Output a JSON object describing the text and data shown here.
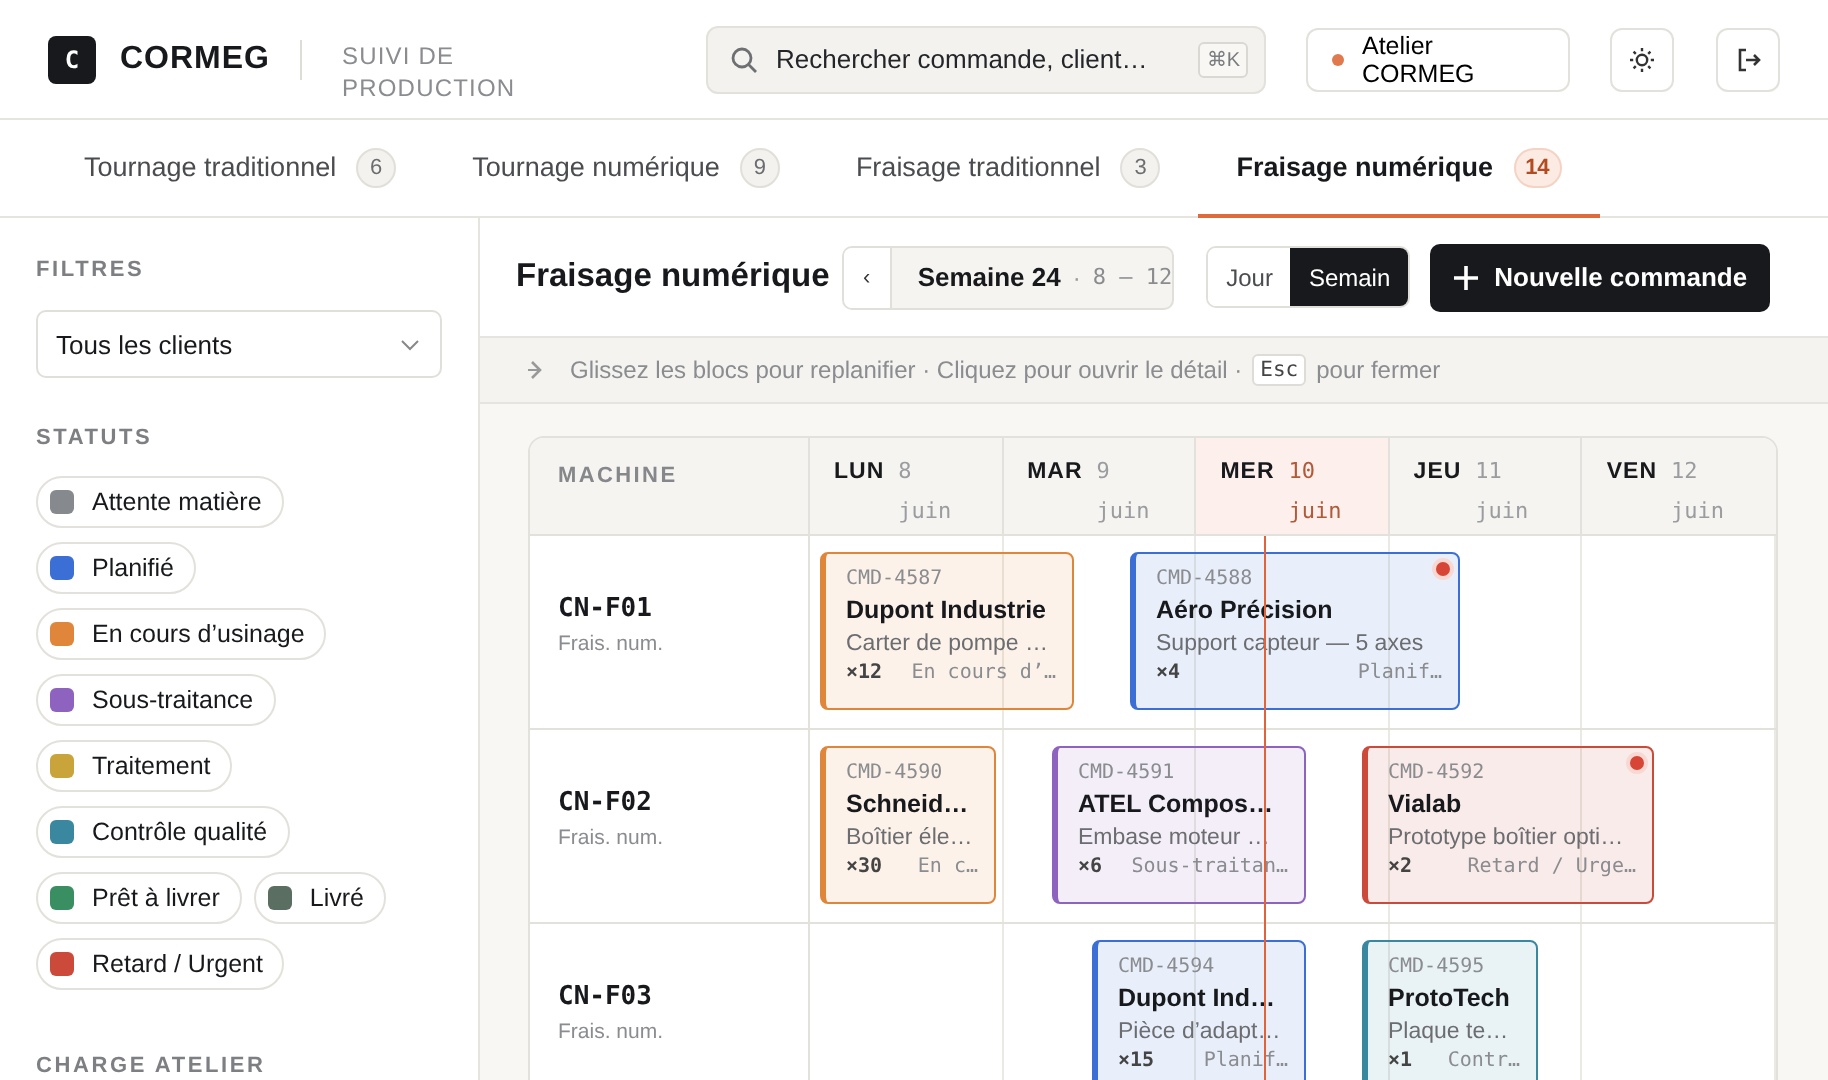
{
  "header": {
    "logo_letter": "C",
    "brand": "CORMEG",
    "subtitle": "SUIVI DE PRODUCTION",
    "search": {
      "placeholder": "Rechercher commande, client…",
      "shortcut": "⌘K"
    },
    "workshop": "Atelier CORMEG"
  },
  "tabs": [
    {
      "label": "Tournage traditionnel",
      "count": "6",
      "selected": false
    },
    {
      "label": "Tournage numérique",
      "count": "9",
      "selected": false
    },
    {
      "label": "Fraisage traditionnel",
      "count": "3",
      "selected": false
    },
    {
      "label": "Fraisage numérique",
      "count": "14",
      "selected": true
    }
  ],
  "sidebar": {
    "filters_title": "FILTRES",
    "client_select": {
      "value": "Tous les clients"
    },
    "statuses_title": "STATUTS",
    "statuses": [
      {
        "label": "Attente matière",
        "color": "#868a8e"
      },
      {
        "label": "Planifié",
        "color": "#3b6fd6"
      },
      {
        "label": "En cours d’usinage",
        "color": "#e0863a"
      },
      {
        "label": "Sous-traitance",
        "color": "#8e62bf"
      },
      {
        "label": "Traitement",
        "color": "#c9a43a"
      },
      {
        "label": "Contrôle qualité",
        "color": "#3a88a0"
      },
      {
        "label": "Prêt à livrer",
        "color": "#3a8f62"
      },
      {
        "label": "Livré",
        "color": "#5b6e62"
      },
      {
        "label": "Retard / Urgent",
        "color": "#cc4a3a"
      }
    ],
    "load_title": "CHARGE ATELIER"
  },
  "toolbar": {
    "title": "Fraisage numérique",
    "week": {
      "prev": "‹",
      "label": "Semaine 24",
      "separator": "·",
      "range": "8 — 12"
    },
    "views": [
      {
        "label": "Jour",
        "selected": false
      },
      {
        "label": "Semain",
        "selected": true
      }
    ],
    "new_button": "Nouvelle commande"
  },
  "hint": {
    "before": "Glissez les blocs pour replanifier · Cliquez pour ouvrir le détail ·",
    "key": "Esc",
    "after": "pour fermer"
  },
  "planning": {
    "machine_header": "MACHINE",
    "days": [
      {
        "name": "LUN",
        "date": "8",
        "month": "juin",
        "today": false
      },
      {
        "name": "MAR",
        "date": "9",
        "month": "juin",
        "today": false
      },
      {
        "name": "MER",
        "date": "10",
        "month": "juin",
        "today": true
      },
      {
        "name": "JEU",
        "date": "11",
        "month": "juin",
        "today": false
      },
      {
        "name": "VEN",
        "date": "12",
        "month": "juin",
        "today": false
      }
    ],
    "rows": [
      {
        "machine": "CN-F01",
        "type": "Frais. num.",
        "orders": [
          {
            "id": "CMD-4587",
            "client": "Dupont Industrie",
            "description": "Carter de pompe …",
            "qty": "×12",
            "status": "En cours d’…",
            "color": "#e0863a",
            "alert": false
          },
          {
            "id": "CMD-4588",
            "client": "Aéro Précision",
            "description": "Support capteur — 5 axes",
            "qty": "×4",
            "status": "Planif…",
            "color": "#3b6fd6",
            "alert": true
          }
        ]
      },
      {
        "machine": "CN-F02",
        "type": "Frais. num.",
        "orders": [
          {
            "id": "CMD-4590",
            "client": "Schneid…",
            "description": "Boîtier éle…",
            "qty": "×30",
            "status": "En c…",
            "color": "#e0863a",
            "alert": false
          },
          {
            "id": "CMD-4591",
            "client": "ATEL Compos…",
            "description": "Embase moteur …",
            "qty": "×6",
            "status": "Sous-traitan…",
            "color": "#8e62bf",
            "alert": false
          },
          {
            "id": "CMD-4592",
            "client": "Vialab",
            "description": "Prototype boîtier opti…",
            "qty": "×2",
            "status": "Retard / Urge…",
            "color": "#cc4a3a",
            "alert": true
          }
        ]
      },
      {
        "machine": "CN-F03",
        "type": "Frais. num.",
        "orders": [
          {
            "id": "CMD-4594",
            "client": "Dupont Ind…",
            "description": "Pièce d’adapt…",
            "qty": "×15",
            "status": "Planif…",
            "color": "#3b6fd6",
            "alert": false
          },
          {
            "id": "CMD-4595",
            "client": "ProtoTech",
            "description": "Plaque te…",
            "qty": "×1",
            "status": "Contr…",
            "color": "#3a88a0",
            "alert": false
          }
        ]
      }
    ]
  }
}
